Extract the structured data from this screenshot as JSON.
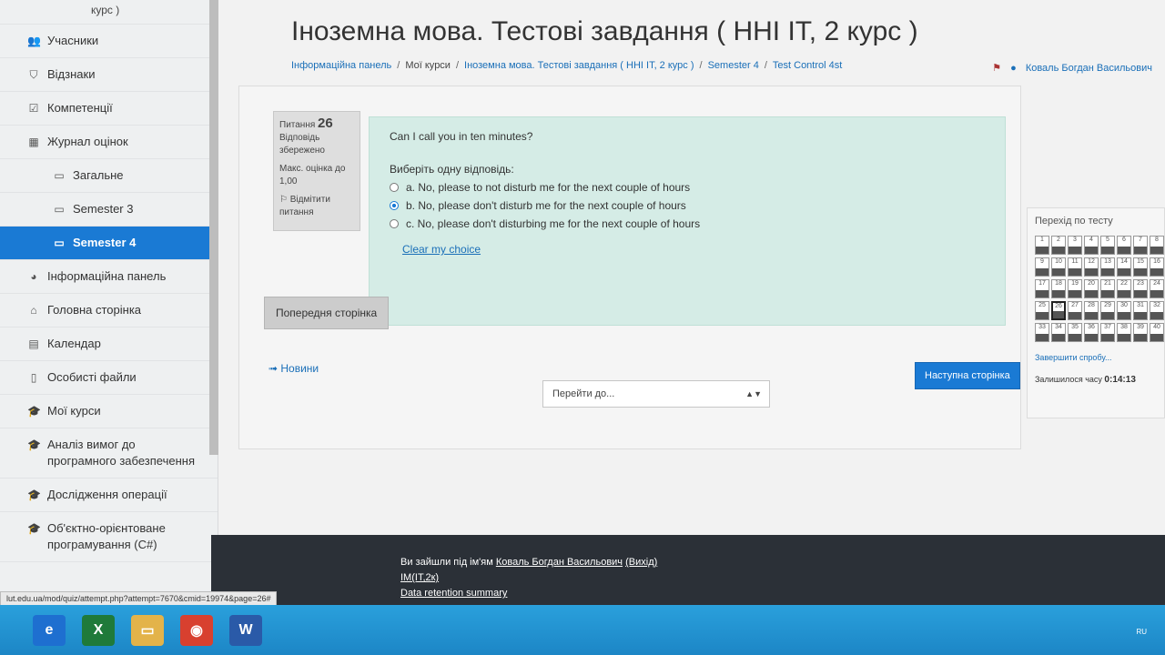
{
  "sidebar": {
    "top_partial": "курс )",
    "items": [
      {
        "label": "Учасники",
        "icon": "users-icon",
        "glyph": "👥"
      },
      {
        "label": "Відзнаки",
        "icon": "shield-icon",
        "glyph": "⛉"
      },
      {
        "label": "Компетенції",
        "icon": "checkbox-icon",
        "glyph": "☑"
      },
      {
        "label": "Журнал оцінок",
        "icon": "table-icon",
        "glyph": "▦"
      },
      {
        "label": "Загальне",
        "icon": "folder-icon",
        "glyph": "▭"
      },
      {
        "label": "Semester 3",
        "icon": "folder-icon",
        "glyph": "▭"
      },
      {
        "label": "Semester 4",
        "icon": "folder-icon",
        "glyph": "▭"
      },
      {
        "label": "Інформаційна панель",
        "icon": "dashboard-icon",
        "glyph": "◕"
      },
      {
        "label": "Головна сторінка",
        "icon": "home-icon",
        "glyph": "⌂"
      },
      {
        "label": "Календар",
        "icon": "calendar-icon",
        "glyph": "▤"
      },
      {
        "label": "Особисті файли",
        "icon": "file-icon",
        "glyph": "▯"
      },
      {
        "label": "Мої курси",
        "icon": "graduation-cap-icon",
        "glyph": "🎓"
      },
      {
        "label": "Аналіз вимог до програмного забезпечення",
        "icon": "graduation-cap-icon",
        "glyph": "🎓"
      },
      {
        "label": "Дослідження операції",
        "icon": "graduation-cap-icon",
        "glyph": "🎓"
      },
      {
        "label": "Об'єктно-орієнтоване програмування (C#)",
        "icon": "graduation-cap-icon",
        "glyph": "🎓"
      }
    ]
  },
  "header": {
    "title": "Іноземна мова. Тестові завдання ( ННІ ІТ, 2 курс )",
    "breadcrumb": [
      "Інформаційна панель",
      "Мої курси",
      "Іноземна мова. Тестові завдання ( ННІ ІТ, 2 курс )",
      "Semester 4",
      "Test Control 4st"
    ],
    "user_name": "Коваль Богдан Васильович"
  },
  "question_info": {
    "label": "Питання",
    "number": "26",
    "status": "Відповідь збережено",
    "max_grade": "Макс. оцінка до 1,00",
    "flag": "Відмітити питання"
  },
  "question": {
    "text": "Can I call you in ten minutes?",
    "prompt": "Виберіть одну відповідь:",
    "options": [
      {
        "label": "a. No, please to not disturb me for the next couple of hours",
        "selected": false
      },
      {
        "label": "b. No, please don't disturb me for the next couple of hours",
        "selected": true
      },
      {
        "label": "c. No, please don't disturbing me for the next couple of hours",
        "selected": false
      }
    ],
    "clear": "Clear my choice"
  },
  "nav": {
    "prev": "Попередня сторінка",
    "next": "Наступна сторінка",
    "news": "➟ Новини",
    "jump_placeholder": "Перейти до..."
  },
  "quiz_nav": {
    "title": "Перехід по тесту",
    "questions": [
      "1",
      "2",
      "3",
      "4",
      "5",
      "6",
      "7",
      "8",
      "9",
      "10",
      "11",
      "12",
      "13",
      "14",
      "15",
      "16",
      "17",
      "18",
      "19",
      "20",
      "21",
      "22",
      "23",
      "24",
      "25",
      "26",
      "27",
      "28",
      "29",
      "30",
      "31",
      "32",
      "33",
      "34",
      "35",
      "36",
      "37",
      "38",
      "39",
      "40"
    ],
    "current": "26",
    "finish": "Завершити спробу...",
    "time_label": "Залишилося часу",
    "time_value": "0:14:13"
  },
  "footer": {
    "logged_prefix": "Ви зайшли під ім'ям",
    "user": "Коваль Богдан Васильович",
    "logout": "(Вихід)",
    "group": "ІМ(ІТ,2к)",
    "data_retention": "Data retention summary"
  },
  "status_url": "lut.edu.ua/mod/quiz/attempt.php?attempt=7670&cmid=19974&page=26#",
  "taskbar": {
    "apps": [
      {
        "name": "internet-explorer-icon",
        "glyph": "e",
        "color": "#1e6fd0"
      },
      {
        "name": "excel-icon",
        "glyph": "X",
        "color": "#1f7a3a"
      },
      {
        "name": "file-explorer-icon",
        "glyph": "▭",
        "color": "#e3b34a"
      },
      {
        "name": "chrome-icon",
        "glyph": "◉",
        "color": "#d8402f"
      },
      {
        "name": "word-icon",
        "glyph": "W",
        "color": "#2a5aa8"
      }
    ],
    "lang": "RU"
  }
}
